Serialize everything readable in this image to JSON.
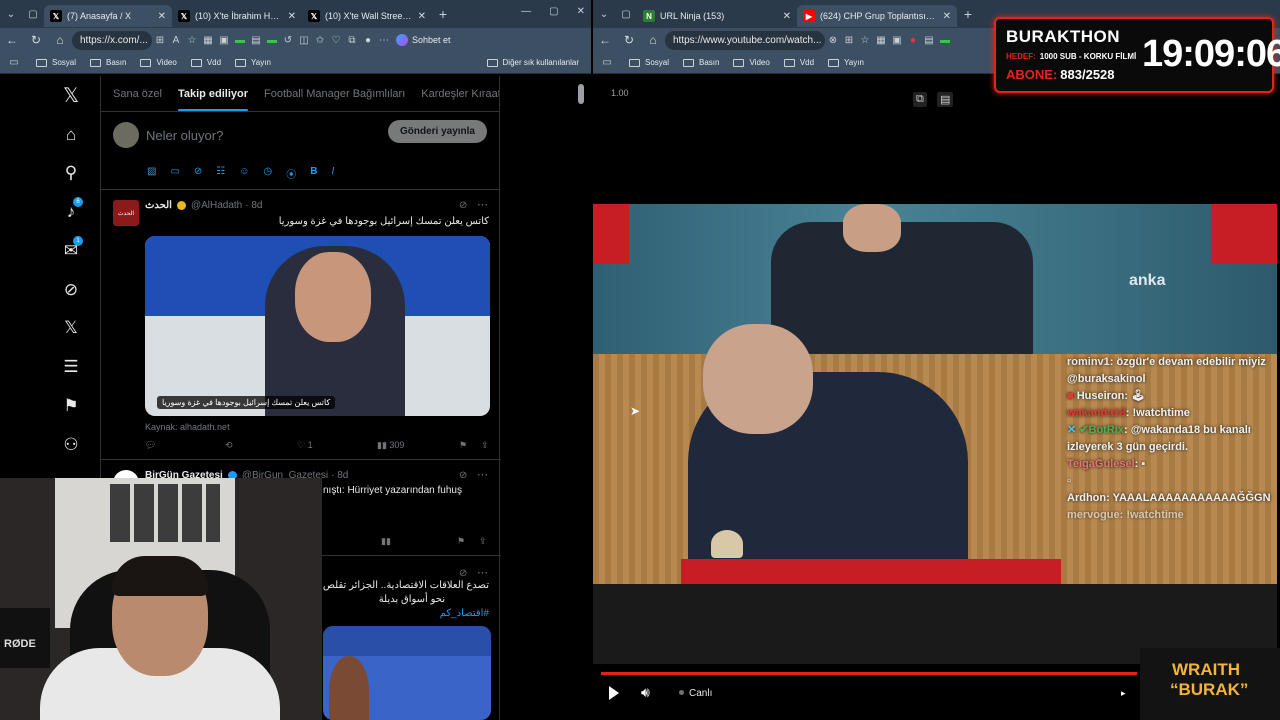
{
  "left_browser": {
    "tabs": [
      {
        "title": "(7) Anasayfa / X",
        "active": true
      },
      {
        "title": "(10) X'te İbrahim Haskolo",
        "active": false
      },
      {
        "title": "(10) X'te Wall Street Tercü",
        "active": false
      }
    ],
    "url": "https://x.com/...",
    "chat_button": "Sohbet et",
    "bookmarks": [
      "Sosyal",
      "Basın",
      "Video",
      "Vdd",
      "Yayın"
    ],
    "bookmarks_other": "Diğer sık kullanılanlar"
  },
  "twitter": {
    "nav_badges": {
      "notifications": "6",
      "messages": "1"
    },
    "feed_tabs": [
      "Sana özel",
      "Takip ediliyor",
      "Football Manager Bağımlıları",
      "Kardeşler Kıraath"
    ],
    "active_tab": "Takip ediliyor",
    "compose_placeholder": "Neler oluyor?",
    "post_button": "Gönderi yayınla",
    "tweets": [
      {
        "name": "الحدث",
        "handle": "@AlHadath",
        "time": "· 8d",
        "text": "كاتس يعلن تمسك إسرائيل بوجودها في غزة وسوريا",
        "image_caption": "كاتس يعلن تمسك إسرائيل بوجودها في غزة وسوريا",
        "source": "Kaynak: alhadath.net",
        "likes": "1",
        "views": "309"
      },
      {
        "name": "BirGün Gazetesi",
        "handle": "@BirGun_Gazetesi",
        "time": "· 8d",
        "text": "nıştı: Hürriyet yazarından fuhuş"
      },
      {
        "text_line1": "تصدع العلاقات الاقتصادية.. الجزائر تقلص",
        "text_line2": "نحو أسواق بديلة",
        "hashtag": "#اقتصاد_كم"
      }
    ]
  },
  "right_browser": {
    "tabs": [
      {
        "title": "URL Ninja (153)",
        "active": false
      },
      {
        "title": "(624) CHP Grup Toplantısı / TBMM",
        "active": true
      }
    ],
    "url": "https://www.youtube.com/watch...",
    "bookmarks": [
      "Sosyal",
      "Basın",
      "Video",
      "Vdd",
      "Yayın"
    ]
  },
  "youtube": {
    "speed_label": "1.00",
    "watermark": "anka",
    "live_label": "Canlı",
    "progress": 0.78
  },
  "chat": [
    {
      "user": "rominv1",
      "text": "özgür'e devam edebilir miyiz @buraksakinol"
    },
    {
      "user": "Huseiron",
      "text": ""
    },
    {
      "user": "wakanda18",
      "text": "!watchtime"
    },
    {
      "user": "BotRix",
      "text": "@wakanda18 bu kanalı izleyerek 3 gün geçirdi."
    },
    {
      "user": "TeigaGulesel",
      "text": ""
    },
    {
      "user": "Ardhon",
      "text": "YAAALAAAAAAAAAAAĞĞGN"
    },
    {
      "user": "mervogue",
      "text": "!watchtime"
    }
  ],
  "overlay": {
    "title": "BURAKTHON",
    "hedef_label": "HEDEF:",
    "hedef_text": "1000 SUB - KORKU FİLMİ",
    "abone_label": "ABONE:",
    "abone_value": "883/2528",
    "clock": "19:09:06"
  },
  "brand_overlay": {
    "line1": "WRAITH",
    "line2": "“BURAK”"
  },
  "webcam": {
    "mic_brand": "RØDE"
  }
}
